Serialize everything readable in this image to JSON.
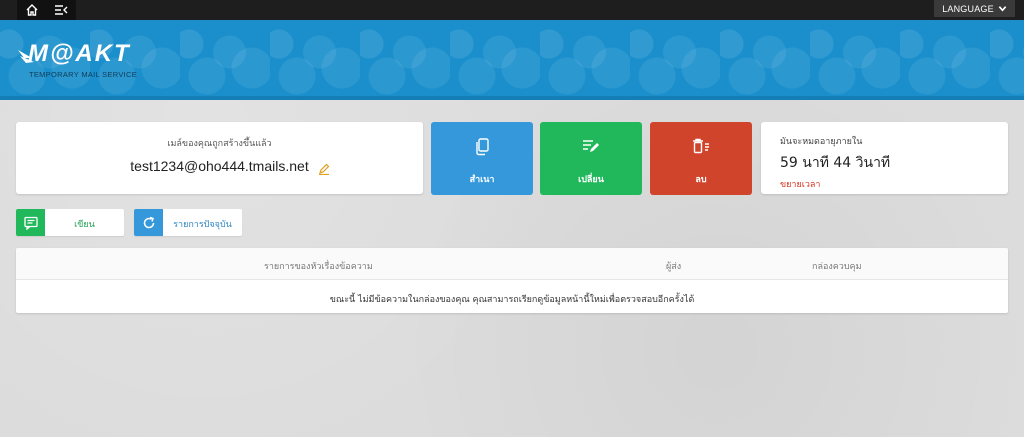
{
  "topbar": {
    "home_icon": "home-icon",
    "menu_icon": "menu-collapse-icon",
    "language_label": "LANGUAGE",
    "language_icon": "chevron-down-icon"
  },
  "header": {
    "logo_text": "M@AKT",
    "logo_subtitle": "TEMPORARY MAIL SERVICE",
    "colors": {
      "header_bg": "#1a8fcc",
      "topbar_bg": "#1e1e1e"
    }
  },
  "email_card": {
    "label": "เมล์ของคุณถูกสร้างขึ้นแล้ว",
    "address": "test1234@oho444.tmails.net",
    "edit_icon": "pencil-icon"
  },
  "actions": {
    "copy": {
      "label": "สำเนา",
      "icon": "copy-icon",
      "color": "#3498db"
    },
    "change": {
      "label": "เปลี่ยน",
      "icon": "edit-list-icon",
      "color": "#21b85c"
    },
    "delete": {
      "label": "ลบ",
      "icon": "trash-icon",
      "color": "#d0442c"
    }
  },
  "expire_card": {
    "title": "มันจะหมดอายุภายใน",
    "time": "59 นาที 44 วินาที",
    "extend_label": "ขยายเวลา"
  },
  "buttons": {
    "write_label": "เขียน",
    "write_icon": "message-icon",
    "refresh_label": "รายการปัจจุบัน",
    "refresh_icon": "refresh-icon"
  },
  "inbox": {
    "columns": [
      "รายการของหัวเรื่องข้อความ",
      "ผู้ส่ง",
      "กล่องควบคุม"
    ],
    "empty_message": "ขณะนี้ ไม่มีข้อความในกล่องของคุณ คุณสามารถเรียกดูข้อมูลหน้านี้ใหม่เพื่อตรวจสอบอีกครั้งได้"
  }
}
